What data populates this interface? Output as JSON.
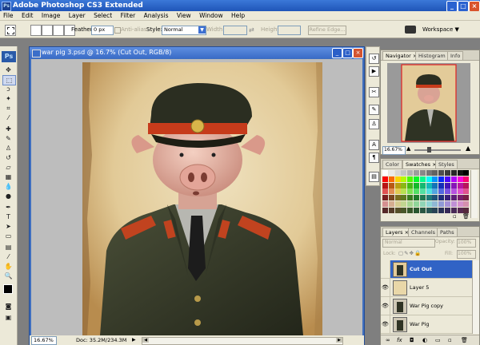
{
  "app": {
    "title": "Adobe Photoshop CS3 Extended",
    "logo_text": "Ps",
    "window_controls": [
      "_",
      "□",
      "×"
    ]
  },
  "menu": [
    "File",
    "Edit",
    "Image",
    "Layer",
    "Select",
    "Filter",
    "Analysis",
    "View",
    "Window",
    "Help"
  ],
  "options_bar": {
    "feather_label": "Feather:",
    "feather_value": "0 px",
    "antialias_label": "Anti-alias",
    "style_label": "Style:",
    "style_value": "Normal",
    "width_label": "Width:",
    "height_label": "Height:",
    "refine_edge_label": "Refine Edge...",
    "workspace_label": "Workspace ▼"
  },
  "document": {
    "title": "war pig 3.psd @ 16.7% (Cut Out, RGB/8)",
    "zoom": "16.67%",
    "doc_size": "Doc: 35.2M/234.3M"
  },
  "navigator": {
    "tabs": [
      "Navigator",
      "Histogram",
      "Info"
    ],
    "zoom": "16.67%"
  },
  "color_panel": {
    "tabs": [
      "Color",
      "Swatches",
      "Styles"
    ]
  },
  "layers_panel": {
    "tabs": [
      "Layers",
      "Channels",
      "Paths"
    ],
    "blend_mode": "Normal",
    "opacity_label": "Opacity:",
    "opacity_value": "100%",
    "lock_label": "Lock:",
    "fill_label": "Fill:",
    "fill_value": "100%",
    "layers": [
      {
        "name": "Cut Out",
        "selected": true
      },
      {
        "name": "Layer 5",
        "selected": false
      },
      {
        "name": "War Pig  copy",
        "selected": false
      },
      {
        "name": "War Pig",
        "selected": false
      }
    ],
    "bottom_icons": [
      "link-icon",
      "fx-icon",
      "mask-icon",
      "adjustment-icon",
      "group-icon",
      "new-layer-icon",
      "trash-icon"
    ]
  }
}
